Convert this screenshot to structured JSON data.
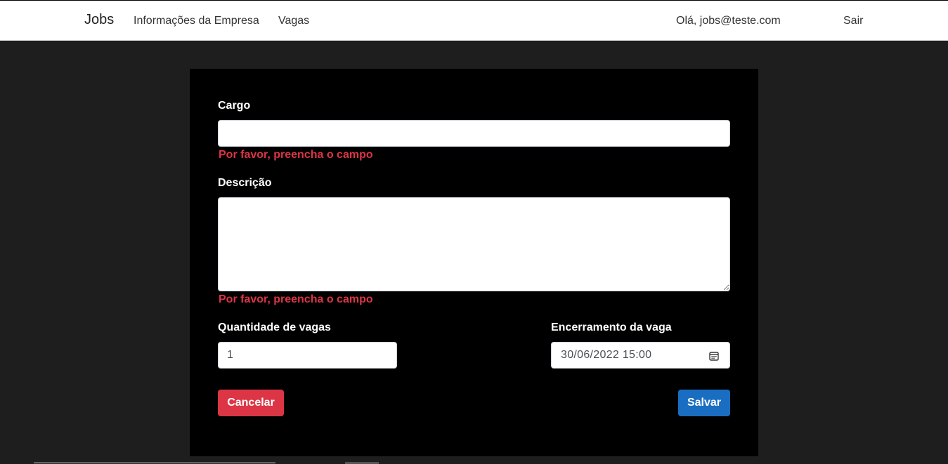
{
  "nav": {
    "brand": "Jobs",
    "links": [
      "Informações da Empresa",
      "Vagas"
    ],
    "greeting": "Olá, jobs@teste.com",
    "logout": "Sair"
  },
  "form": {
    "cargo_label": "Cargo",
    "cargo_value": "",
    "cargo_error": "Por favor, preencha o campo",
    "descricao_label": "Descrição",
    "descricao_value": "",
    "descricao_error": "Por favor, preencha o campo",
    "quantidade_label": "Quantidade de vagas",
    "quantidade_value": "1",
    "encerramento_label": "Encerramento da vaga",
    "encerramento_value": "30/06/2022 15:00",
    "cancel_label": "Cancelar",
    "save_label": "Salvar"
  },
  "colors": {
    "background": "#1e1e1e",
    "card": "#000000",
    "error": "#dc3545",
    "primary": "#1a6ec2",
    "danger": "#dc3545"
  },
  "icons": {
    "date": "calendar-icon"
  }
}
